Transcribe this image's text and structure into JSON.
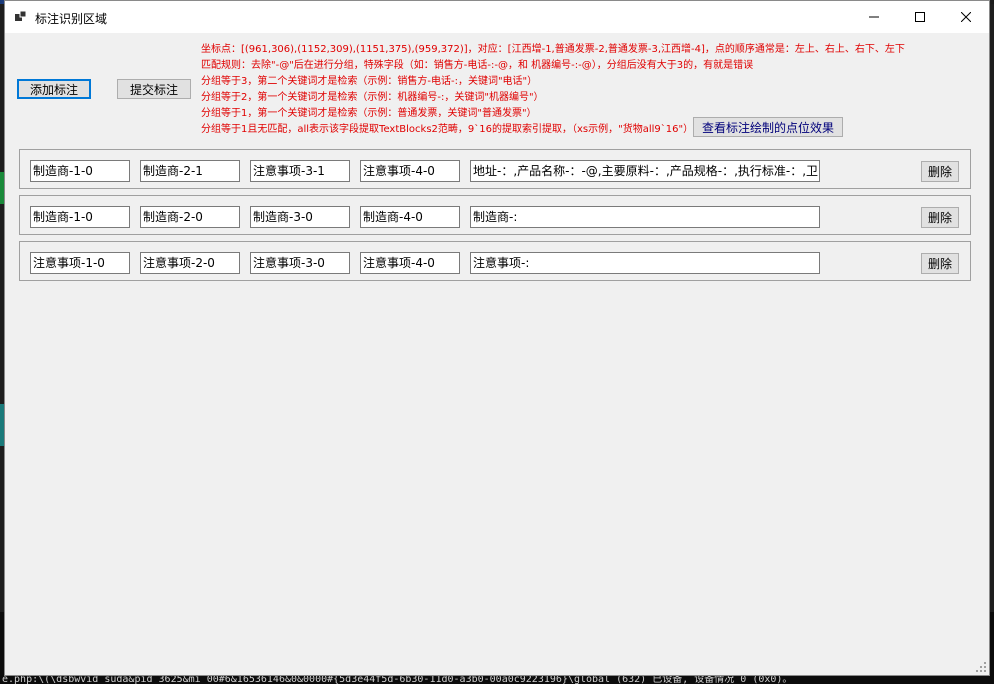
{
  "window": {
    "title": "标注识别区域",
    "controls": {
      "minimize_icon": "minimize-icon",
      "maximize_icon": "maximize-icon",
      "close_icon": "close-icon"
    }
  },
  "toolbar": {
    "add_label": "添加标注",
    "submit_label": "提交标注",
    "view_points_label": "查看标注绘制的点位效果"
  },
  "instructions": [
    "坐标点：[(961,306),(1152,309),(1151,375),(959,372)]，对应：[江西增-1,普通发票-2,普通发票-3,江西增-4]，点的顺序通常是：左上、右上、右下、左下",
    "匹配规则：去除\"-@\"后在进行分组，特殊字段（如：销售方-电话-:-@，和 机器编号-:-@），分组后没有大于3的，有就是错误",
    "分组等于3，第二个关键词才是检索（示例：销售方-电话-:，关键词\"电话\"）",
    "分组等于2，第一个关键词才是检索（示例：机器编号-:，关键词\"机器编号\"）",
    "分组等于1，第一个关键词才是检索（示例：普通发票，关键词\"普通发票\"）",
    "分组等于1且无匹配，all表示该字段提取TextBlocks2范畴，9`16的提取索引提取，（xs示例，\"货物all9`16\"）"
  ],
  "rows": [
    {
      "fields": [
        "制造商-1-0",
        "制造商-2-1",
        "注意事项-3-1",
        "注意事项-4-0"
      ],
      "rule": "地址-：,产品名称-：-@,主要原料-：,产品规格-：,执行标准-：,卫",
      "delete_label": "删除"
    },
    {
      "fields": [
        "制造商-1-0",
        "制造商-2-0",
        "制造商-3-0",
        "制造商-4-0"
      ],
      "rule": "制造商-:",
      "delete_label": "删除"
    },
    {
      "fields": [
        "注意事项-1-0",
        "注意事项-2-0",
        "注意事项-3-0",
        "注意事项-4-0"
      ],
      "rule": "注意事项-:",
      "delete_label": "删除"
    }
  ],
  "background_console": [
    "e.php:\\(\\dsbwvid_suda&pid_3625&mi_00#6&16536146&0&0000#{5d3e44f5d-6b30-11d0-a3b0-00a0c9223196}\\global (632) 已设备, 设备情况 0 (0x0)。"
  ],
  "colors": {
    "instruction_text": "#e00000",
    "focus_border": "#0078d7",
    "window_bg": "#f0f0f0"
  }
}
